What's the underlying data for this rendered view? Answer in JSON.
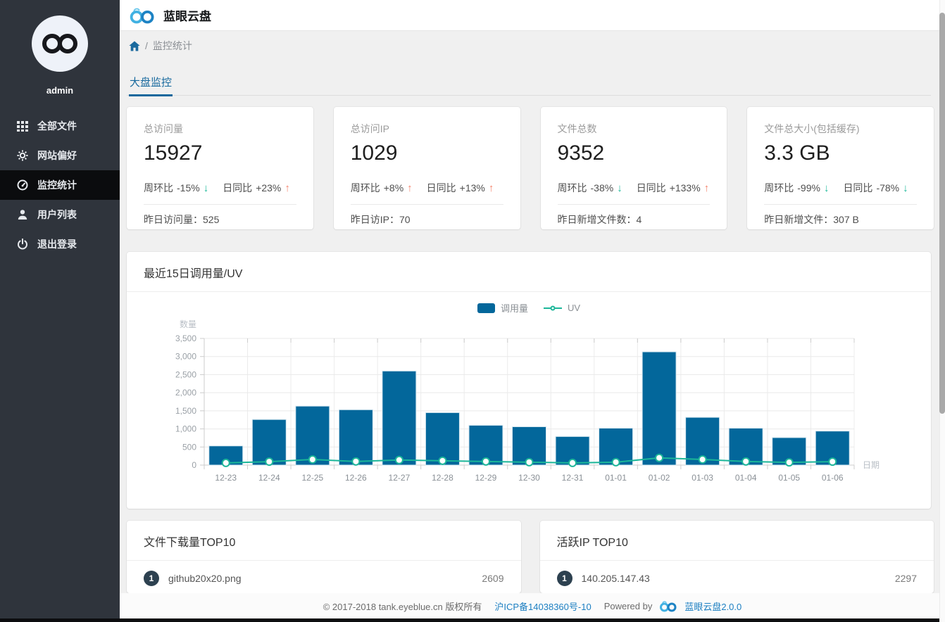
{
  "app": {
    "title": "蓝眼云盘"
  },
  "sidebar": {
    "username": "admin",
    "active_index": 2,
    "items": [
      {
        "label": "全部文件",
        "icon": "grid-icon"
      },
      {
        "label": "网站偏好",
        "icon": "gear-icon"
      },
      {
        "label": "监控统计",
        "icon": "dashboard-icon"
      },
      {
        "label": "用户列表",
        "icon": "user-icon"
      },
      {
        "label": "退出登录",
        "icon": "power-icon"
      }
    ]
  },
  "breadcrumb": {
    "separator": "/",
    "current": "监控统计"
  },
  "tab": {
    "label": "大盘监控"
  },
  "stat_cards": [
    {
      "label": "总访问量",
      "value": "15927",
      "week_label": "周环比",
      "week_value": "-15%",
      "week_trend": "down",
      "week_arrow": "↓",
      "day_label": "日同比",
      "day_value": "+23%",
      "day_trend": "up",
      "day_arrow": "↑",
      "footer_label": "昨日访问量：",
      "footer_value": "525"
    },
    {
      "label": "总访问IP",
      "value": "1029",
      "week_label": "周环比",
      "week_value": "+8%",
      "week_trend": "up",
      "week_arrow": "↑",
      "day_label": "日同比",
      "day_value": "+13%",
      "day_trend": "up",
      "day_arrow": "↑",
      "footer_label": "昨日访IP：",
      "footer_value": "70"
    },
    {
      "label": "文件总数",
      "value": "9352",
      "week_label": "周环比",
      "week_value": "-38%",
      "week_trend": "down",
      "week_arrow": "↓",
      "day_label": "日同比",
      "day_value": "+133%",
      "day_trend": "up",
      "day_arrow": "↑",
      "footer_label": "昨日新增文件数：",
      "footer_value": "4"
    },
    {
      "label": "文件总大小(包括缓存)",
      "value": "3.3 GB",
      "week_label": "周环比",
      "week_value": "-99%",
      "week_trend": "down",
      "week_arrow": "↓",
      "day_label": "日同比",
      "day_value": "-78%",
      "day_trend": "down",
      "day_arrow": "↓",
      "footer_label": "昨日新增文件：",
      "footer_value": "307 B"
    }
  ],
  "chart_card": {
    "title": "最近15日调用量/UV"
  },
  "chart_data": {
    "type": "bar",
    "title": "最近15日调用量/UV",
    "categories": [
      "12-23",
      "12-24",
      "12-25",
      "12-26",
      "12-27",
      "12-28",
      "12-29",
      "12-30",
      "12-31",
      "01-01",
      "01-02",
      "01-03",
      "01-04",
      "01-05",
      "01-06"
    ],
    "series": [
      {
        "name": "调用量",
        "type": "bar",
        "color": "#03679b",
        "values": [
          530,
          1260,
          1630,
          1530,
          2600,
          1450,
          1100,
          1060,
          790,
          1020,
          3130,
          1320,
          1020,
          760,
          940
        ]
      },
      {
        "name": "UV",
        "type": "line",
        "color": "#1cb699",
        "values": [
          60,
          95,
          155,
          100,
          140,
          120,
          100,
          80,
          60,
          80,
          200,
          155,
          100,
          75,
          95
        ]
      }
    ],
    "xlabel": "日期",
    "ylabel": "数量",
    "ylim": [
      0,
      3500
    ],
    "yticks": [
      "0",
      "500",
      "1,000",
      "1,500",
      "2,000",
      "2,500",
      "3,000",
      "3,500"
    ],
    "grid": true,
    "legend_position": "top-center"
  },
  "top_lists": [
    {
      "title": "文件下载量TOP10",
      "rows": [
        {
          "rank": "1",
          "name": "github20x20.png",
          "value": "2609"
        }
      ]
    },
    {
      "title": "活跃IP TOP10",
      "rows": [
        {
          "rank": "1",
          "name": "140.205.147.43",
          "value": "2297"
        }
      ]
    }
  ],
  "footer": {
    "copyright": "© 2017-2018 tank.eyeblue.cn 版权所有",
    "icp_link": "沪ICP备14038360号-10",
    "powered_by": "Powered by",
    "brand_link": "蓝眼云盘2.0.0"
  },
  "colors": {
    "accent_blue": "#15689d",
    "bar_blue": "#03679b",
    "line_teal": "#1cb699",
    "up_orange": "#f5846c",
    "down_teal": "#1db99a",
    "badge_navy": "#2d4150",
    "sidebar_bg": "#2f343c",
    "sidebar_active": "#0b0c0e"
  }
}
